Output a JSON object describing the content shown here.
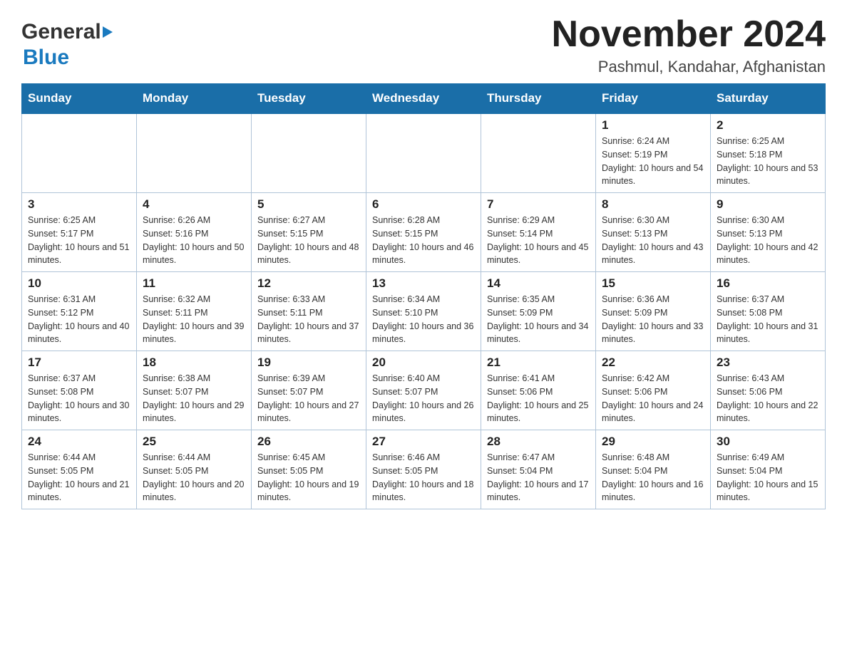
{
  "header": {
    "logo_general": "General",
    "logo_blue": "Blue",
    "month_title": "November 2024",
    "location": "Pashmul, Kandahar, Afghanistan"
  },
  "days_of_week": [
    "Sunday",
    "Monday",
    "Tuesday",
    "Wednesday",
    "Thursday",
    "Friday",
    "Saturday"
  ],
  "weeks": [
    [
      {
        "day": "",
        "info": ""
      },
      {
        "day": "",
        "info": ""
      },
      {
        "day": "",
        "info": ""
      },
      {
        "day": "",
        "info": ""
      },
      {
        "day": "",
        "info": ""
      },
      {
        "day": "1",
        "info": "Sunrise: 6:24 AM\nSunset: 5:19 PM\nDaylight: 10 hours and 54 minutes."
      },
      {
        "day": "2",
        "info": "Sunrise: 6:25 AM\nSunset: 5:18 PM\nDaylight: 10 hours and 53 minutes."
      }
    ],
    [
      {
        "day": "3",
        "info": "Sunrise: 6:25 AM\nSunset: 5:17 PM\nDaylight: 10 hours and 51 minutes."
      },
      {
        "day": "4",
        "info": "Sunrise: 6:26 AM\nSunset: 5:16 PM\nDaylight: 10 hours and 50 minutes."
      },
      {
        "day": "5",
        "info": "Sunrise: 6:27 AM\nSunset: 5:15 PM\nDaylight: 10 hours and 48 minutes."
      },
      {
        "day": "6",
        "info": "Sunrise: 6:28 AM\nSunset: 5:15 PM\nDaylight: 10 hours and 46 minutes."
      },
      {
        "day": "7",
        "info": "Sunrise: 6:29 AM\nSunset: 5:14 PM\nDaylight: 10 hours and 45 minutes."
      },
      {
        "day": "8",
        "info": "Sunrise: 6:30 AM\nSunset: 5:13 PM\nDaylight: 10 hours and 43 minutes."
      },
      {
        "day": "9",
        "info": "Sunrise: 6:30 AM\nSunset: 5:13 PM\nDaylight: 10 hours and 42 minutes."
      }
    ],
    [
      {
        "day": "10",
        "info": "Sunrise: 6:31 AM\nSunset: 5:12 PM\nDaylight: 10 hours and 40 minutes."
      },
      {
        "day": "11",
        "info": "Sunrise: 6:32 AM\nSunset: 5:11 PM\nDaylight: 10 hours and 39 minutes."
      },
      {
        "day": "12",
        "info": "Sunrise: 6:33 AM\nSunset: 5:11 PM\nDaylight: 10 hours and 37 minutes."
      },
      {
        "day": "13",
        "info": "Sunrise: 6:34 AM\nSunset: 5:10 PM\nDaylight: 10 hours and 36 minutes."
      },
      {
        "day": "14",
        "info": "Sunrise: 6:35 AM\nSunset: 5:09 PM\nDaylight: 10 hours and 34 minutes."
      },
      {
        "day": "15",
        "info": "Sunrise: 6:36 AM\nSunset: 5:09 PM\nDaylight: 10 hours and 33 minutes."
      },
      {
        "day": "16",
        "info": "Sunrise: 6:37 AM\nSunset: 5:08 PM\nDaylight: 10 hours and 31 minutes."
      }
    ],
    [
      {
        "day": "17",
        "info": "Sunrise: 6:37 AM\nSunset: 5:08 PM\nDaylight: 10 hours and 30 minutes."
      },
      {
        "day": "18",
        "info": "Sunrise: 6:38 AM\nSunset: 5:07 PM\nDaylight: 10 hours and 29 minutes."
      },
      {
        "day": "19",
        "info": "Sunrise: 6:39 AM\nSunset: 5:07 PM\nDaylight: 10 hours and 27 minutes."
      },
      {
        "day": "20",
        "info": "Sunrise: 6:40 AM\nSunset: 5:07 PM\nDaylight: 10 hours and 26 minutes."
      },
      {
        "day": "21",
        "info": "Sunrise: 6:41 AM\nSunset: 5:06 PM\nDaylight: 10 hours and 25 minutes."
      },
      {
        "day": "22",
        "info": "Sunrise: 6:42 AM\nSunset: 5:06 PM\nDaylight: 10 hours and 24 minutes."
      },
      {
        "day": "23",
        "info": "Sunrise: 6:43 AM\nSunset: 5:06 PM\nDaylight: 10 hours and 22 minutes."
      }
    ],
    [
      {
        "day": "24",
        "info": "Sunrise: 6:44 AM\nSunset: 5:05 PM\nDaylight: 10 hours and 21 minutes."
      },
      {
        "day": "25",
        "info": "Sunrise: 6:44 AM\nSunset: 5:05 PM\nDaylight: 10 hours and 20 minutes."
      },
      {
        "day": "26",
        "info": "Sunrise: 6:45 AM\nSunset: 5:05 PM\nDaylight: 10 hours and 19 minutes."
      },
      {
        "day": "27",
        "info": "Sunrise: 6:46 AM\nSunset: 5:05 PM\nDaylight: 10 hours and 18 minutes."
      },
      {
        "day": "28",
        "info": "Sunrise: 6:47 AM\nSunset: 5:04 PM\nDaylight: 10 hours and 17 minutes."
      },
      {
        "day": "29",
        "info": "Sunrise: 6:48 AM\nSunset: 5:04 PM\nDaylight: 10 hours and 16 minutes."
      },
      {
        "day": "30",
        "info": "Sunrise: 6:49 AM\nSunset: 5:04 PM\nDaylight: 10 hours and 15 minutes."
      }
    ]
  ]
}
